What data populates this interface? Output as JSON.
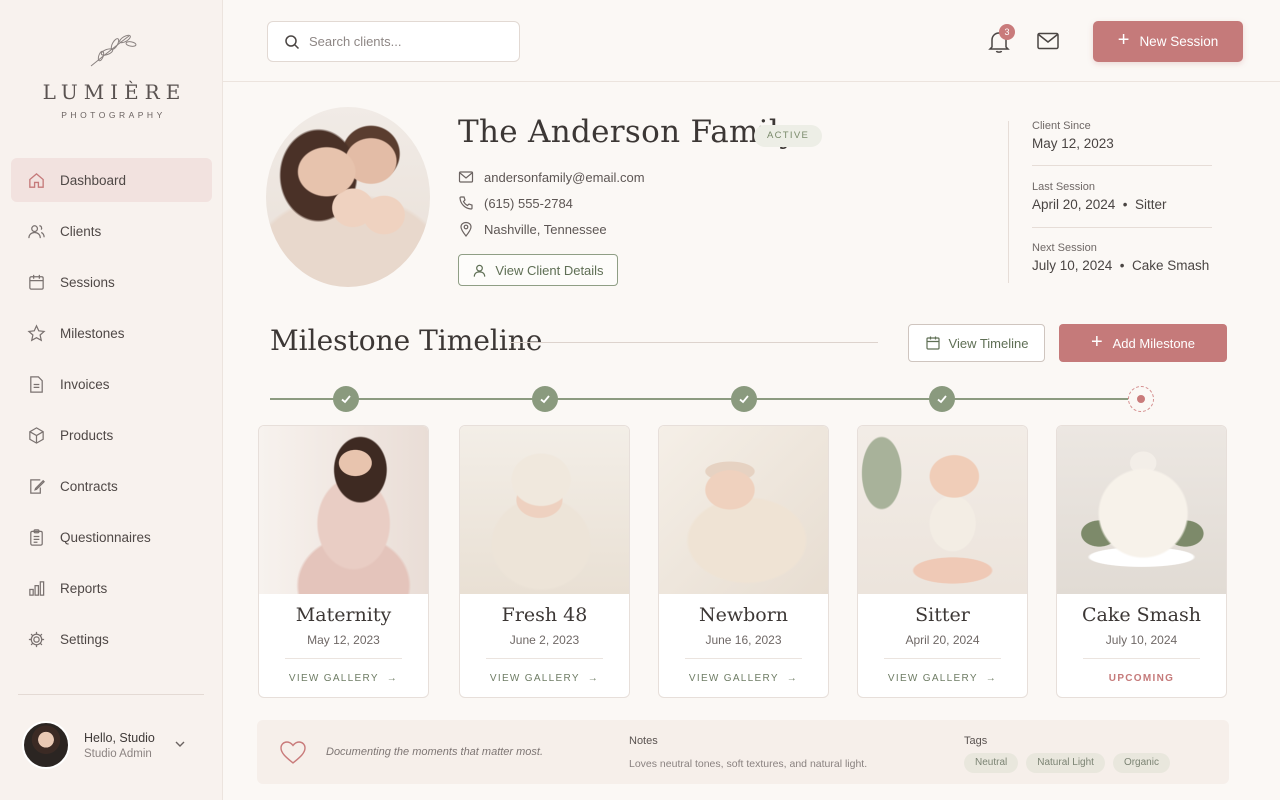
{
  "brand": {
    "name": "LUMIÈRE",
    "sub": "PHOTOGRAPHY"
  },
  "sidebar": {
    "items": [
      {
        "label": "Dashboard",
        "icon": "home-icon",
        "active": true
      },
      {
        "label": "Clients",
        "icon": "users-icon"
      },
      {
        "label": "Sessions",
        "icon": "calendar-icon"
      },
      {
        "label": "Milestones",
        "icon": "star-icon"
      },
      {
        "label": "Invoices",
        "icon": "invoice-icon"
      },
      {
        "label": "Products",
        "icon": "box-icon"
      },
      {
        "label": "Contracts",
        "icon": "contract-icon"
      },
      {
        "label": "Questionnaires",
        "icon": "clipboard-icon"
      },
      {
        "label": "Reports",
        "icon": "bar-chart-icon"
      },
      {
        "label": "Settings",
        "icon": "gear-icon"
      }
    ],
    "user": {
      "greeting": "Hello, Studio",
      "role": "Studio Admin"
    }
  },
  "topbar": {
    "search_placeholder": "Search clients...",
    "notification_count": "3",
    "new_session_label": "New Session"
  },
  "client": {
    "name": "The Anderson Family",
    "status": "ACTIVE",
    "email": "andersonfamily@email.com",
    "phone": "(615) 555-2784",
    "location": "Nashville, Tennessee",
    "details_button": "View Client Details",
    "client_since_label": "Client Since",
    "client_since": "May 12, 2023",
    "last_session_label": "Last Session",
    "last_session": "April 20, 2024  •  Sitter",
    "next_session_label": "Next Session",
    "next_session": "July 10, 2024  •  Cake Smash"
  },
  "milestones": {
    "title": "Milestone Timeline",
    "view_timeline_label": "View Timeline",
    "add_label": "Add Milestone",
    "cards": [
      {
        "title": "Maternity",
        "date": "May 12, 2023",
        "action": "VIEW GALLERY  →",
        "status": "done"
      },
      {
        "title": "Fresh 48",
        "date": "June 2, 2023",
        "action": "VIEW GALLERY  →",
        "status": "done"
      },
      {
        "title": "Newborn",
        "date": "June 16, 2023",
        "action": "VIEW GALLERY  →",
        "status": "done"
      },
      {
        "title": "Sitter",
        "date": "April 20, 2024",
        "action": "VIEW GALLERY  →",
        "status": "done"
      },
      {
        "title": "Cake Smash",
        "date": "July 10, 2024",
        "action": "UPCOMING",
        "status": "upcoming"
      }
    ]
  },
  "footer": {
    "quote": "Documenting the moments that matter most.",
    "notes_label": "Notes",
    "notes": "Loves neutral tones, soft textures, and natural light.",
    "tags_label": "Tags",
    "tags": [
      "Neutral",
      "Natural Light",
      "Organic"
    ]
  },
  "colors": {
    "accent": "#c57a7a",
    "sage": "#8a9a7e",
    "background": "#fbf8f5"
  }
}
